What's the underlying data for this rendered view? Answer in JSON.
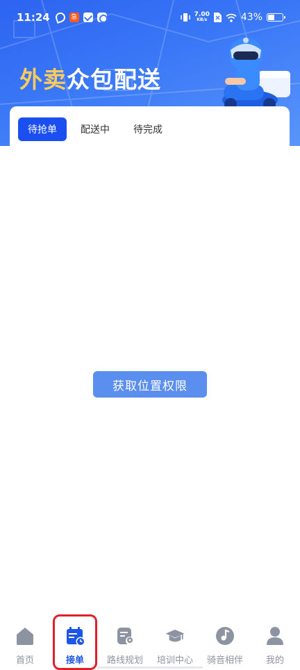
{
  "status_bar": {
    "time": "11:24",
    "notif_badge": "急",
    "net_speed": "7.00",
    "net_unit": "KB/s",
    "battery_percent": "43%",
    "battery_level": 0.43
  },
  "banner": {
    "title_accent": "外卖",
    "title_rest": "众包配送"
  },
  "tabs": [
    {
      "label": "待抢单",
      "active": true
    },
    {
      "label": "配送中",
      "active": false
    },
    {
      "label": "待完成",
      "active": false
    }
  ],
  "main": {
    "location_button_label": "获取位置权限"
  },
  "bottom_nav": [
    {
      "label": "首页",
      "icon": "home-icon",
      "active": false
    },
    {
      "label": "接单",
      "icon": "order-calendar-icon",
      "active": true
    },
    {
      "label": "路线规划",
      "icon": "route-plan-icon",
      "active": false
    },
    {
      "label": "培训中心",
      "icon": "graduation-cap-icon",
      "active": false
    },
    {
      "label": "骑音相伴",
      "icon": "music-disc-icon",
      "active": false
    },
    {
      "label": "我的",
      "icon": "user-icon",
      "active": false
    }
  ],
  "colors": {
    "brand_blue": "#1c4ff0",
    "banner_blue": "#3a78f7",
    "title_accent": "#ffcb5c",
    "active_nav": "#1c56e8",
    "inactive_nav": "#8d93a0",
    "button": "#5a8ff0",
    "highlight": "#e0202a"
  }
}
